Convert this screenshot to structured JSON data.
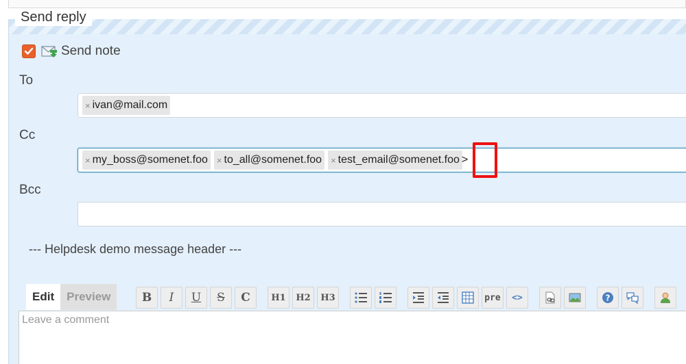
{
  "section": {
    "title": "Send reply"
  },
  "send_note": {
    "label": "Send note",
    "checked": true
  },
  "fields": {
    "to": {
      "label": "To",
      "tags": [
        "ivan@mail.com"
      ]
    },
    "cc": {
      "label": "Cc",
      "tags": [
        "my_boss@somenet.foo",
        "to_all@somenet.foo",
        "test_email@somenet.foo"
      ],
      "typed": ">"
    },
    "bcc": {
      "label": "Bcc",
      "tags": []
    }
  },
  "header_text": "--- Helpdesk demo message header ---",
  "editor": {
    "tabs": [
      {
        "label": "Edit",
        "active": true
      },
      {
        "label": "Preview",
        "active": false
      }
    ],
    "toolbar": {
      "bold": "B",
      "italic": "I",
      "underline": "U",
      "strike": "S",
      "code": "C",
      "h1": "H1",
      "h2": "H2",
      "h3": "H3",
      "pre": "pre",
      "inline_code": "<>"
    },
    "comment_placeholder": "Leave a comment"
  },
  "tag_remove_glyph": "×",
  "colors": {
    "panel_bg": "#e4f0fb",
    "checkbox": "#e8612c",
    "highlight": "#ee1111",
    "focus_border": "#3a8db5"
  }
}
